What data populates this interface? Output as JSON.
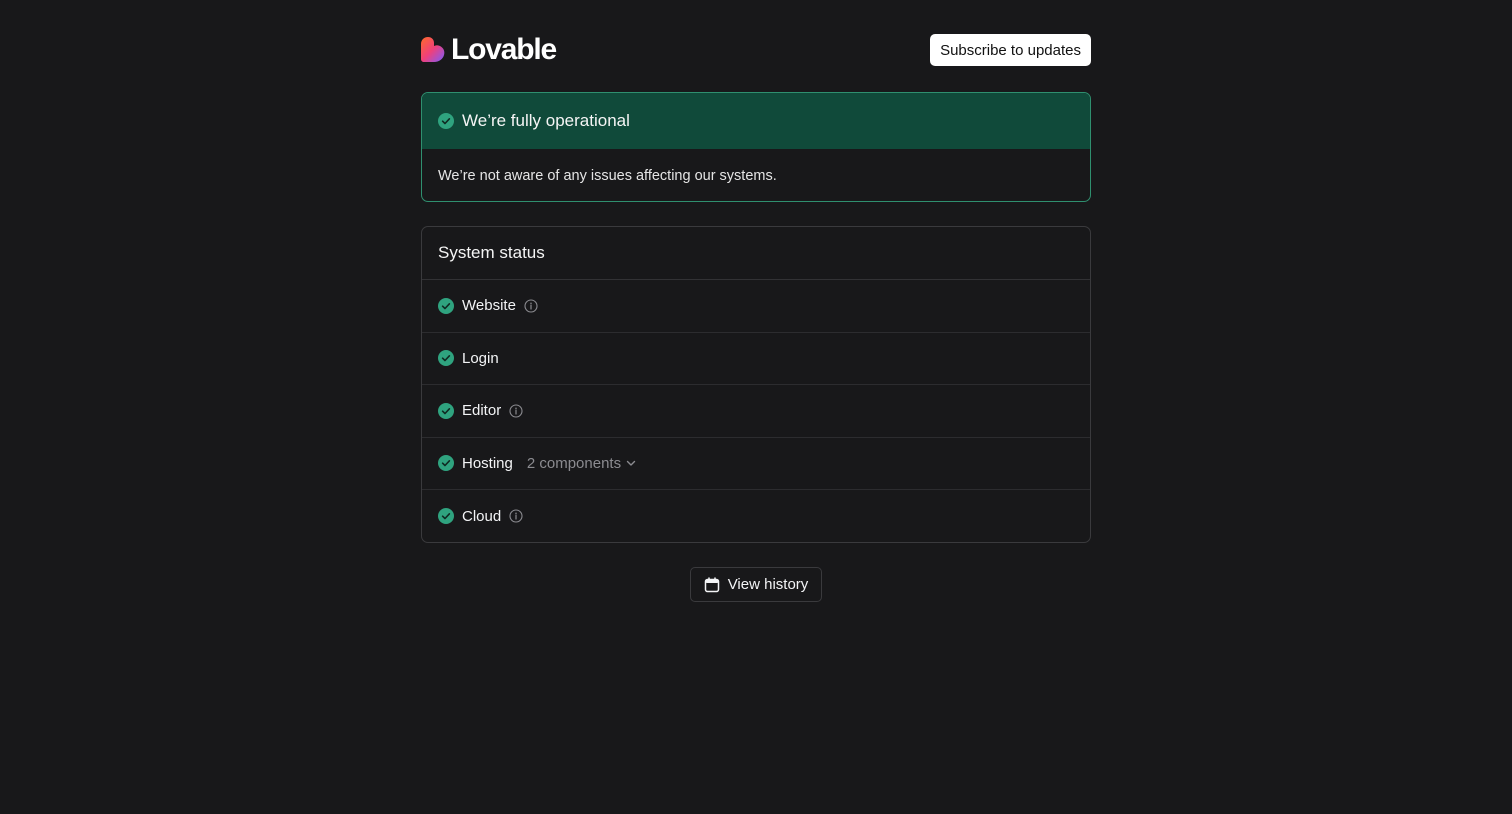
{
  "brand": {
    "name": "Lovable"
  },
  "header": {
    "subscribe_label": "Subscribe to updates"
  },
  "banner": {
    "title": "We’re fully operational",
    "message": "We’re not aware of any issues affecting our systems."
  },
  "system_status": {
    "title": "System status",
    "components": [
      {
        "label": "Website",
        "icon": "check-circle-icon",
        "has_info": true
      },
      {
        "label": "Login",
        "icon": "check-circle-icon",
        "has_info": false
      },
      {
        "label": "Editor",
        "icon": "check-circle-icon",
        "has_info": true
      },
      {
        "label": "Hosting",
        "icon": "check-circle-icon",
        "has_info": false,
        "subcomponents_label": "2 components"
      },
      {
        "label": "Cloud",
        "icon": "check-circle-icon",
        "has_info": true
      }
    ]
  },
  "history": {
    "label": "View history"
  },
  "colors": {
    "background": "#18181a",
    "operational": "#2fa37f",
    "banner_header": "#104a3a"
  }
}
